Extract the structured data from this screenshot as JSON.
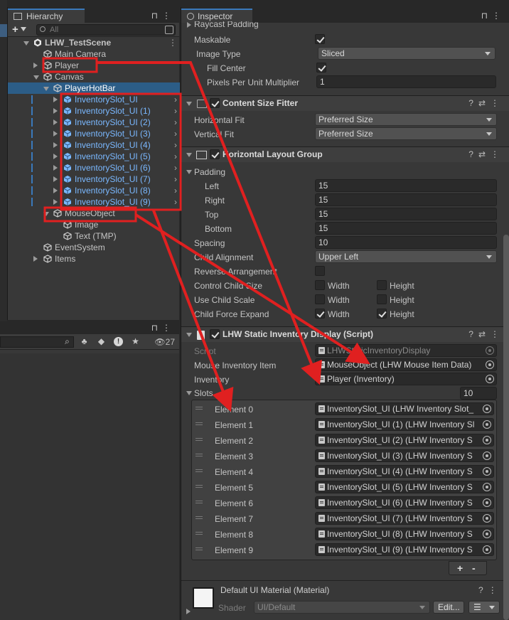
{
  "hierarchy": {
    "tab_label": "Hierarchy",
    "search_placeholder": "All",
    "scene": "LHW_TestScene",
    "items": [
      {
        "label": "Main Camera"
      },
      {
        "label": "Player"
      },
      {
        "label": "Canvas"
      },
      {
        "label": "PlayerHotBar"
      },
      {
        "label": "InventorySlot_UI"
      },
      {
        "label": "InventorySlot_UI (1)"
      },
      {
        "label": "InventorySlot_UI (2)"
      },
      {
        "label": "InventorySlot_UI (3)"
      },
      {
        "label": "InventorySlot_UI (4)"
      },
      {
        "label": "InventorySlot_UI (5)"
      },
      {
        "label": "InventorySlot_UI (6)"
      },
      {
        "label": "InventorySlot_UI (7)"
      },
      {
        "label": "InventorySlot_UI (8)"
      },
      {
        "label": "InventorySlot_UI (9)"
      },
      {
        "label": "MouseObject"
      },
      {
        "label": "Image"
      },
      {
        "label": "Text (TMP)"
      },
      {
        "label": "EventSystem"
      },
      {
        "label": "Items"
      }
    ]
  },
  "project": {
    "hidden_count": "27"
  },
  "inspector": {
    "tab_label": "Inspector",
    "raycast_padding": "Raycast Padding",
    "maskable": "Maskable",
    "image_type_label": "Image Type",
    "image_type_value": "Sliced",
    "fill_center": "Fill Center",
    "ppu_label": "Pixels Per Unit Multiplier",
    "ppu_value": "1",
    "csf": {
      "title": "Content Size Fitter",
      "h_label": "Horizontal Fit",
      "h_value": "Preferred Size",
      "v_label": "Vertical Fit",
      "v_value": "Preferred Size"
    },
    "hlg": {
      "title": "Horizontal Layout Group",
      "padding": "Padding",
      "left": "Left",
      "left_v": "15",
      "right": "Right",
      "right_v": "15",
      "top": "Top",
      "top_v": "15",
      "bottom": "Bottom",
      "bottom_v": "15",
      "spacing": "Spacing",
      "spacing_v": "10",
      "child_alignment": "Child Alignment",
      "child_alignment_v": "Upper Left",
      "reverse": "Reverse Arrangement",
      "ctrl_size": "Control Child Size",
      "use_scale": "Use Child Scale",
      "force_expand": "Child Force Expand",
      "width": "Width",
      "height": "Height"
    },
    "script_comp": {
      "title": "LHW Static Inventory Display (Script)",
      "script_label": "Script",
      "script_value": "LHWStaticInventoryDisplay",
      "mouse_label": "Mouse Inventory Item",
      "mouse_value": "MouseObject (LHW Mouse Item Data)",
      "inventory_label": "Inventory",
      "inventory_value": "Player (Inventory)",
      "slots_label": "Slots",
      "slots_count": "10",
      "elements": [
        {
          "name": "Element 0",
          "value": "InventorySlot_UI (LHW Inventory Slot_"
        },
        {
          "name": "Element 1",
          "value": "InventorySlot_UI (1) (LHW Inventory Sl"
        },
        {
          "name": "Element 2",
          "value": "InventorySlot_UI (2) (LHW Inventory S"
        },
        {
          "name": "Element 3",
          "value": "InventorySlot_UI (3) (LHW Inventory S"
        },
        {
          "name": "Element 4",
          "value": "InventorySlot_UI (4) (LHW Inventory S"
        },
        {
          "name": "Element 5",
          "value": "InventorySlot_UI (5) (LHW Inventory S"
        },
        {
          "name": "Element 6",
          "value": "InventorySlot_UI (6) (LHW Inventory S"
        },
        {
          "name": "Element 7",
          "value": "InventorySlot_UI (7) (LHW Inventory S"
        },
        {
          "name": "Element 8",
          "value": "InventorySlot_UI (8) (LHW Inventory S"
        },
        {
          "name": "Element 9",
          "value": "InventorySlot_UI (9) (LHW Inventory S"
        }
      ],
      "plus": "+",
      "minus": "-"
    },
    "material": {
      "title": "Default UI Material (Material)",
      "shader_label": "Shader",
      "shader_value": "UI/Default",
      "edit": "Edit..."
    }
  },
  "colors": {
    "annotation": "#e02020",
    "selection": "#2c5d87",
    "prefab_blue": "#7ab8ff"
  }
}
